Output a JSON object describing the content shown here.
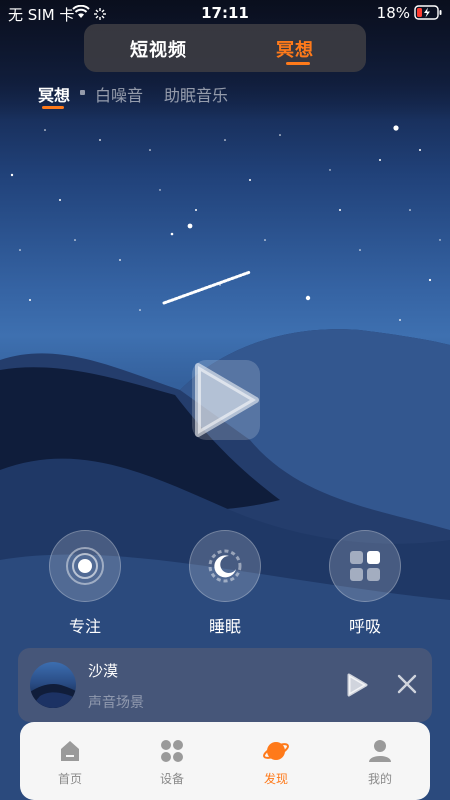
{
  "status_bar": {
    "carrier": "无 SIM 卡",
    "time": "17:11",
    "battery": "18%"
  },
  "top_switch": {
    "tabs": [
      {
        "label": "短视频",
        "active": false
      },
      {
        "label": "冥想",
        "active": true
      }
    ],
    "accent": "#ff7a1a"
  },
  "sub_tabs": [
    {
      "label": "冥想",
      "active": true
    },
    {
      "label": "白噪音",
      "active": false
    },
    {
      "label": "助眠音乐",
      "active": false
    }
  ],
  "hero": {
    "play_icon": "play-icon"
  },
  "modes": [
    {
      "label": "专注",
      "icon": "focus-icon"
    },
    {
      "label": "睡眠",
      "icon": "moon-icon"
    },
    {
      "label": "呼吸",
      "icon": "breath-icon"
    }
  ],
  "mini_player": {
    "title": "沙漠",
    "subtitle": "声音场景",
    "play_icon": "play-icon",
    "close_icon": "close-icon"
  },
  "bottom_nav": [
    {
      "label": "首页",
      "icon": "home-icon",
      "active": false
    },
    {
      "label": "设备",
      "icon": "devices-icon",
      "active": false
    },
    {
      "label": "发现",
      "icon": "planet-icon",
      "active": true
    },
    {
      "label": "我的",
      "icon": "profile-icon",
      "active": false
    }
  ]
}
